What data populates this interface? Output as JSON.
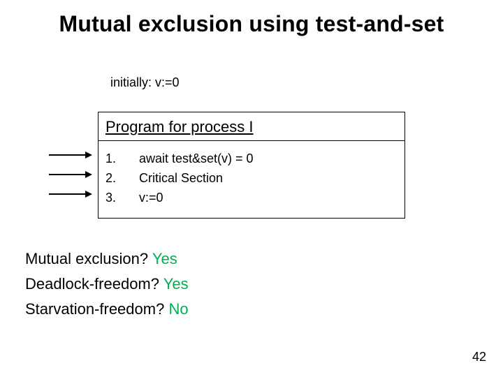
{
  "title": "Mutual exclusion using test-and-set",
  "initially": "initially: v:=0",
  "program": {
    "header": "Program for process I",
    "lines": [
      {
        "num": "1.",
        "text": "await test&set(v) = 0"
      },
      {
        "num": "2.",
        "text": "Critical Section"
      },
      {
        "num": "3.",
        "text": "v:=0"
      }
    ]
  },
  "questions": {
    "mutex_label": "Mutual exclusion?",
    "mutex_answer": "Yes",
    "deadlock_label": "Deadlock-freedom?",
    "deadlock_answer": "Yes",
    "starvation_label": "Starvation-freedom?",
    "starvation_answer": "No"
  },
  "page_number": "42"
}
